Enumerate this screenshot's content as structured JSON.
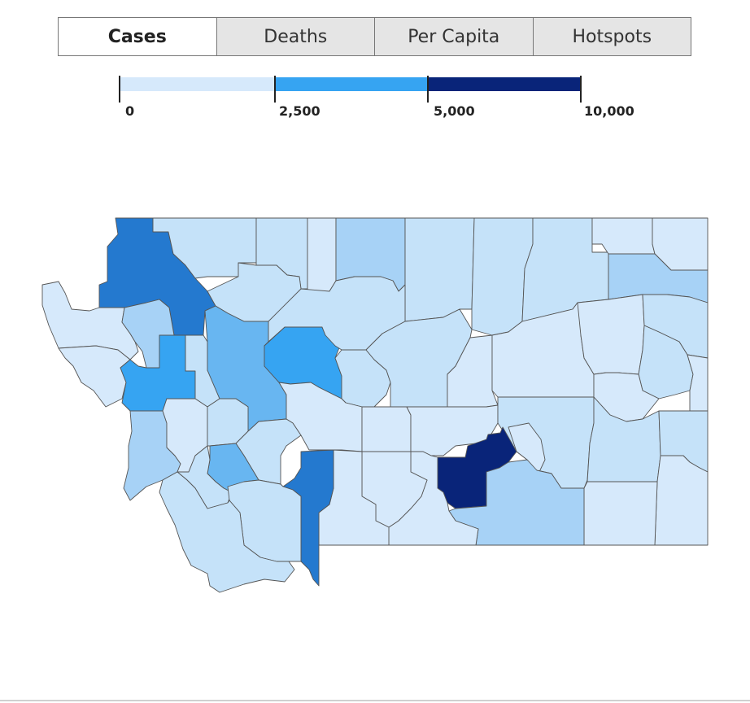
{
  "tabs": [
    {
      "label": "Cases",
      "active": true
    },
    {
      "label": "Deaths",
      "active": false
    },
    {
      "label": "Per Capita",
      "active": false
    },
    {
      "label": "Hotspots",
      "active": false
    }
  ],
  "legend": {
    "labels": [
      "0",
      "2,500",
      "5,000",
      "10,000"
    ],
    "colors": [
      "#d6e9fb",
      "#36a4f2",
      "#092479"
    ]
  },
  "map": {
    "region": "Montana",
    "shading": {
      "very_light": "#d6e9fb",
      "light": "#c5e2f9",
      "light_medium": "#a7d2f6",
      "medium": "#68b6f1",
      "medium_strong": "#36a4f2",
      "strong": "#2479cf",
      "darkest": "#092479"
    }
  }
}
